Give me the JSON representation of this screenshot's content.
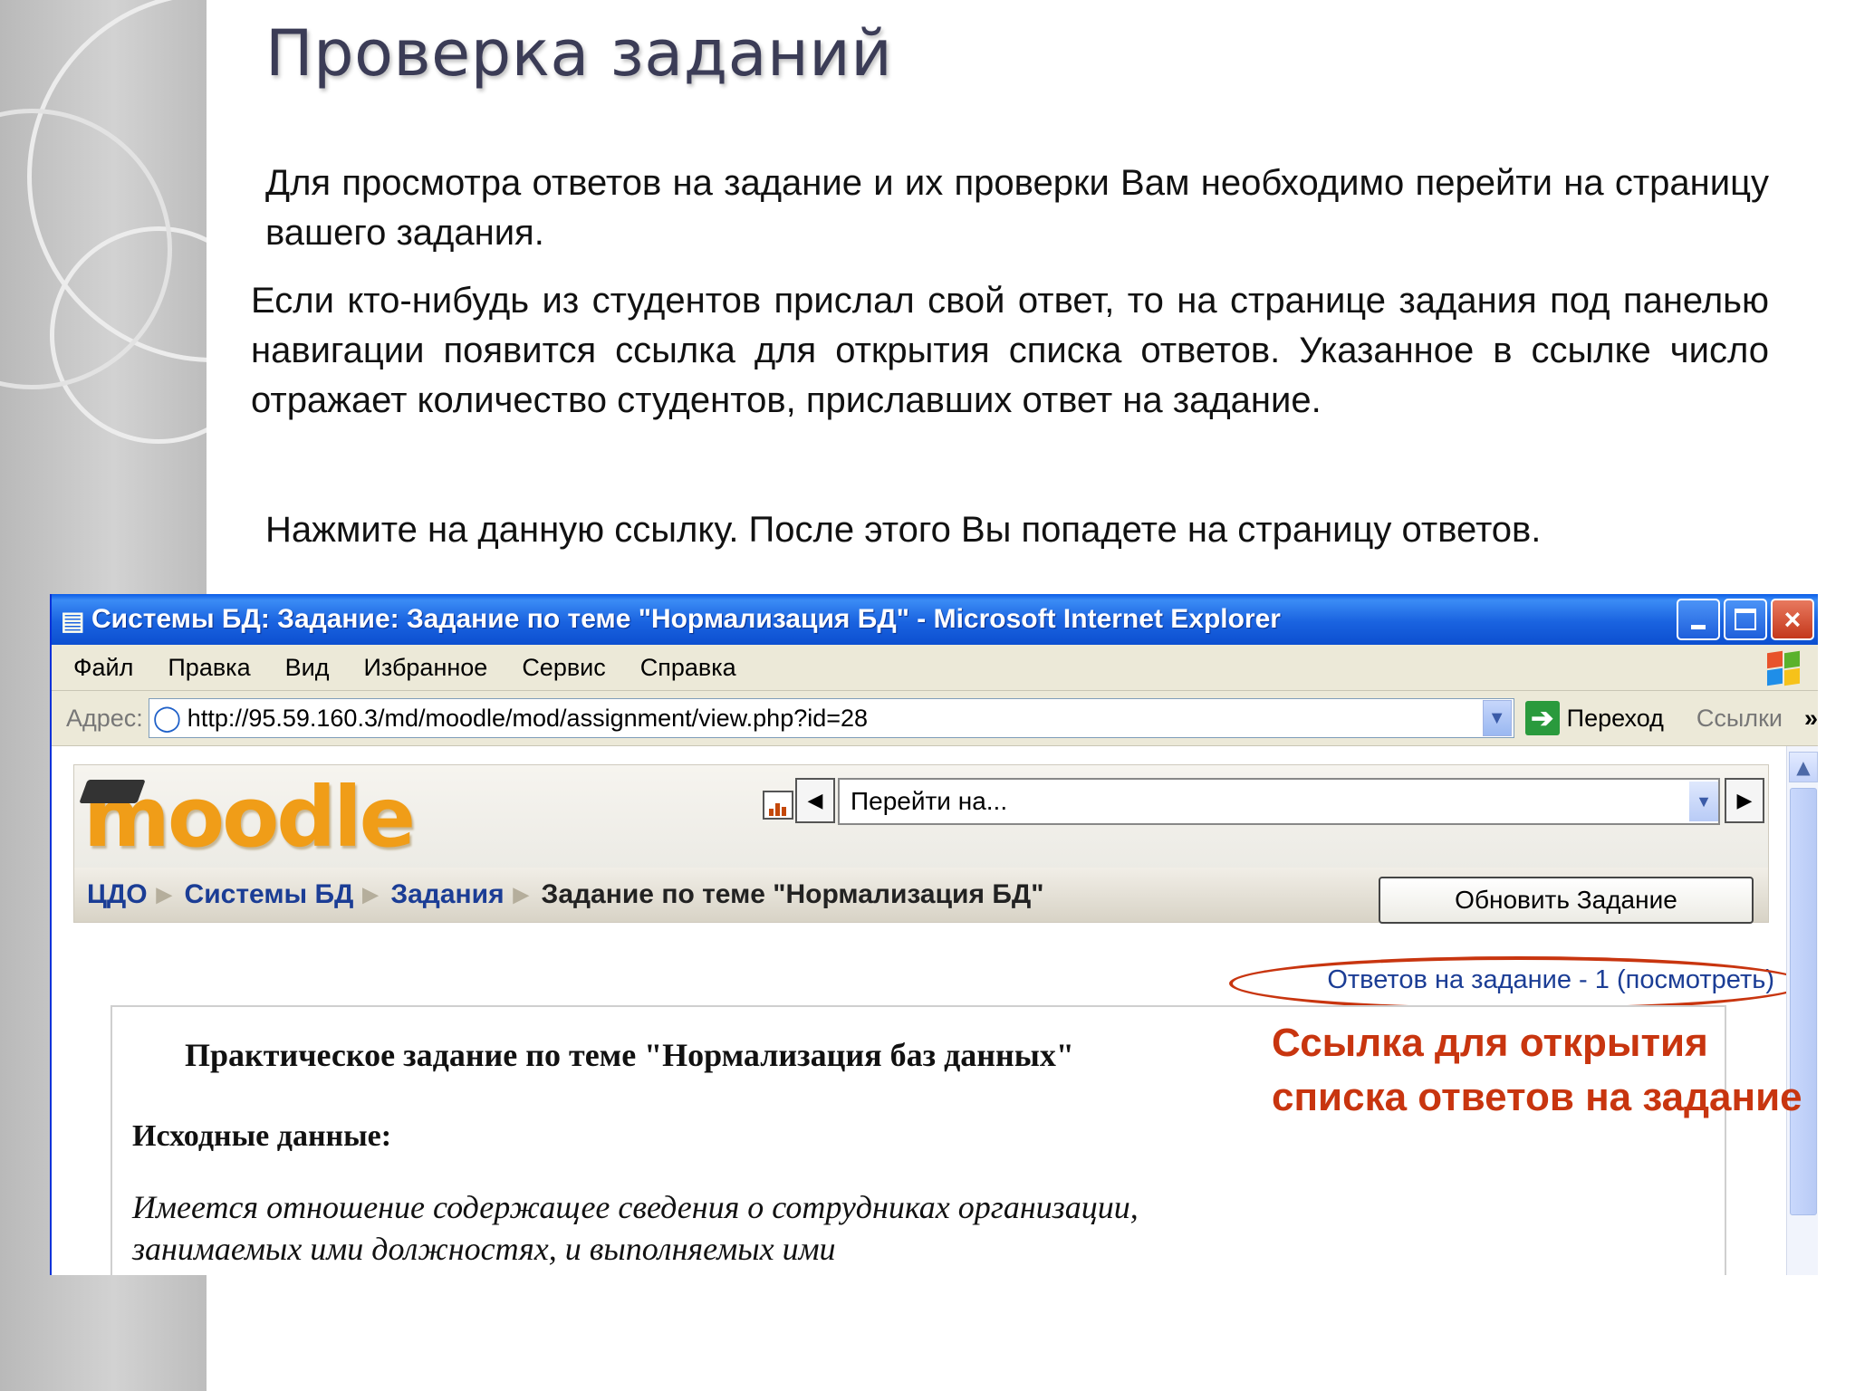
{
  "slide": {
    "title": "Проверка заданий",
    "paragraphs": [
      "Для просмотра ответов на задание и их проверки Вам необходимо перейти на страницу вашего задания.",
      "Если кто-нибудь из студентов прислал свой ответ, то на странице задания под панелью навигации появится ссылка для открытия списка ответов. Указанное в ссылке число отражает количество студентов, приславших ответ на задание.",
      "Нажмите на данную ссылку. После этого Вы попадете на страницу ответов."
    ],
    "callout": "Ссылка для открытия списка ответов на задание",
    "accent_color": "#c8350f"
  },
  "browser": {
    "title": "Системы БД: Задание: Задание по теме \"Нормализация БД\" - Microsoft Internet Explorer",
    "menu": [
      "Файл",
      "Правка",
      "Вид",
      "Избранное",
      "Сервис",
      "Справка"
    ],
    "address_label": "Адрес:",
    "url": "http://95.59.160.3/md/moodle/mod/assignment/view.php?id=28",
    "go_label": "Переход",
    "links_label": "Ссылки"
  },
  "moodle": {
    "logo": "moodle",
    "jump_placeholder": "Перейти на...",
    "breadcrumb": [
      "ЦДО",
      "Системы БД",
      "Задания",
      "Задание по теме \"Нормализация БД\""
    ],
    "update_button": "Обновить Задание",
    "submissions_link": "Ответов на задание - 1 (посмотреть)",
    "assignment_heading": "Практическое задание по теме \"Нормализация баз данных\"",
    "source_data_heading": "Исходные данные:",
    "description": "Имеется отношение содержащее сведения о сотрудниках организации, занимаемых ими должностях, и выполняемых ими"
  }
}
